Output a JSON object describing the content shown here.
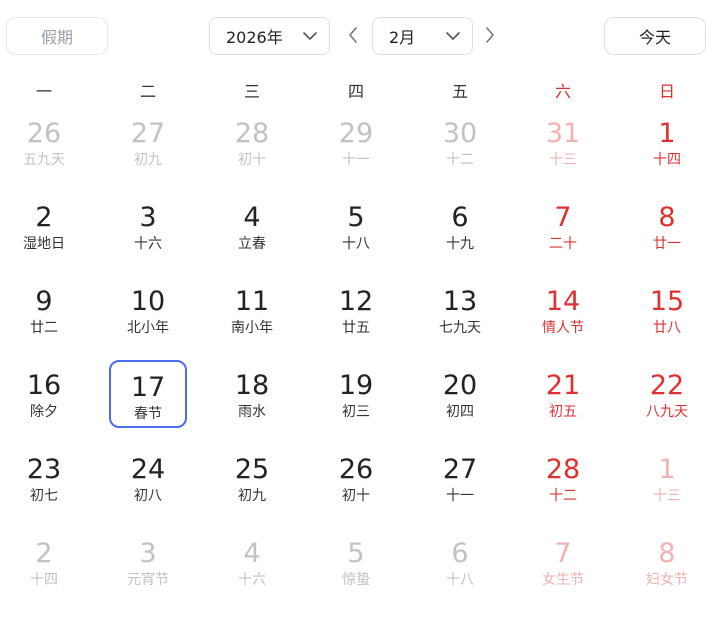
{
  "toolbar": {
    "holiday_label": "假期",
    "year_value": "2026年",
    "month_value": "2月",
    "today_label": "今天"
  },
  "weekdays": [
    "一",
    "二",
    "三",
    "四",
    "五",
    "六",
    "日"
  ],
  "weeks": [
    [
      {
        "day": "26",
        "lunar": "五九天",
        "other": true
      },
      {
        "day": "27",
        "lunar": "初九",
        "other": true
      },
      {
        "day": "28",
        "lunar": "初十",
        "other": true
      },
      {
        "day": "29",
        "lunar": "十一",
        "other": true
      },
      {
        "day": "30",
        "lunar": "十二",
        "other": true
      },
      {
        "day": "31",
        "lunar": "十三",
        "other": true
      },
      {
        "day": "1",
        "lunar": "十四",
        "other": false
      }
    ],
    [
      {
        "day": "2",
        "lunar": "湿地日",
        "other": false
      },
      {
        "day": "3",
        "lunar": "十六",
        "other": false
      },
      {
        "day": "4",
        "lunar": "立春",
        "other": false
      },
      {
        "day": "5",
        "lunar": "十八",
        "other": false
      },
      {
        "day": "6",
        "lunar": "十九",
        "other": false
      },
      {
        "day": "7",
        "lunar": "二十",
        "other": false
      },
      {
        "day": "8",
        "lunar": "廿一",
        "other": false
      }
    ],
    [
      {
        "day": "9",
        "lunar": "廿二",
        "other": false
      },
      {
        "day": "10",
        "lunar": "北小年",
        "other": false
      },
      {
        "day": "11",
        "lunar": "南小年",
        "other": false
      },
      {
        "day": "12",
        "lunar": "廿五",
        "other": false
      },
      {
        "day": "13",
        "lunar": "七九天",
        "other": false
      },
      {
        "day": "14",
        "lunar": "情人节",
        "other": false
      },
      {
        "day": "15",
        "lunar": "廿八",
        "other": false
      }
    ],
    [
      {
        "day": "16",
        "lunar": "除夕",
        "other": false
      },
      {
        "day": "17",
        "lunar": "春节",
        "other": false,
        "selected": true
      },
      {
        "day": "18",
        "lunar": "雨水",
        "other": false
      },
      {
        "day": "19",
        "lunar": "初三",
        "other": false
      },
      {
        "day": "20",
        "lunar": "初四",
        "other": false
      },
      {
        "day": "21",
        "lunar": "初五",
        "other": false
      },
      {
        "day": "22",
        "lunar": "八九天",
        "other": false
      }
    ],
    [
      {
        "day": "23",
        "lunar": "初七",
        "other": false
      },
      {
        "day": "24",
        "lunar": "初八",
        "other": false
      },
      {
        "day": "25",
        "lunar": "初九",
        "other": false
      },
      {
        "day": "26",
        "lunar": "初十",
        "other": false
      },
      {
        "day": "27",
        "lunar": "十一",
        "other": false
      },
      {
        "day": "28",
        "lunar": "十二",
        "other": false
      },
      {
        "day": "1",
        "lunar": "十三",
        "other": true
      }
    ],
    [
      {
        "day": "2",
        "lunar": "十四",
        "other": true
      },
      {
        "day": "3",
        "lunar": "元宵节",
        "other": true
      },
      {
        "day": "4",
        "lunar": "十六",
        "other": true
      },
      {
        "day": "5",
        "lunar": "惊蛰",
        "other": true
      },
      {
        "day": "6",
        "lunar": "十八",
        "other": true
      },
      {
        "day": "7",
        "lunar": "女生节",
        "other": true
      },
      {
        "day": "8",
        "lunar": "妇女节",
        "other": true
      }
    ]
  ],
  "icons": {
    "dropdown": "chevron-down-icon",
    "prev": "chevron-left-icon",
    "next": "chevron-right-icon"
  },
  "colors": {
    "weekend": "#e03131",
    "selected_border": "#4a6cf0",
    "muted": "#c2c2c2"
  }
}
